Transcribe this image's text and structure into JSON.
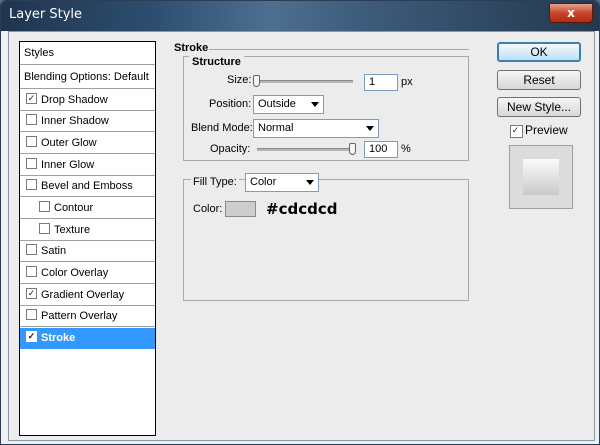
{
  "window": {
    "title": "Layer Style",
    "close_label": "x"
  },
  "styles_list": {
    "header": "Styles",
    "blending": "Blending Options: Default",
    "items": [
      {
        "label": "Drop Shadow",
        "checked": true
      },
      {
        "label": "Inner Shadow",
        "checked": false
      },
      {
        "label": "Outer Glow",
        "checked": false
      },
      {
        "label": "Inner Glow",
        "checked": false
      },
      {
        "label": "Bevel and Emboss",
        "checked": false
      },
      {
        "label": "Contour",
        "checked": false
      },
      {
        "label": "Texture",
        "checked": false
      },
      {
        "label": "Satin",
        "checked": false
      },
      {
        "label": "Color Overlay",
        "checked": false
      },
      {
        "label": "Gradient Overlay",
        "checked": true
      },
      {
        "label": "Pattern Overlay",
        "checked": false
      },
      {
        "label": "Stroke",
        "checked": true
      }
    ]
  },
  "stroke": {
    "title": "Stroke",
    "structure_title": "Structure",
    "size_label": "Size:",
    "size_value": "1",
    "size_unit": "px",
    "position_label": "Position:",
    "position_value": "Outside",
    "blend_mode_label": "Blend Mode:",
    "blend_mode_value": "Normal",
    "opacity_label": "Opacity:",
    "opacity_value": "100",
    "opacity_unit": "%",
    "fill_type_label": "Fill Type:",
    "fill_type_value": "Color",
    "color_label": "Color:",
    "color_value": "#cdcdcd",
    "color_hex_text": "#cdcdcd"
  },
  "buttons": {
    "ok": "OK",
    "reset": "Reset",
    "new_style": "New Style...",
    "preview_label": "Preview",
    "preview_checked": true
  }
}
